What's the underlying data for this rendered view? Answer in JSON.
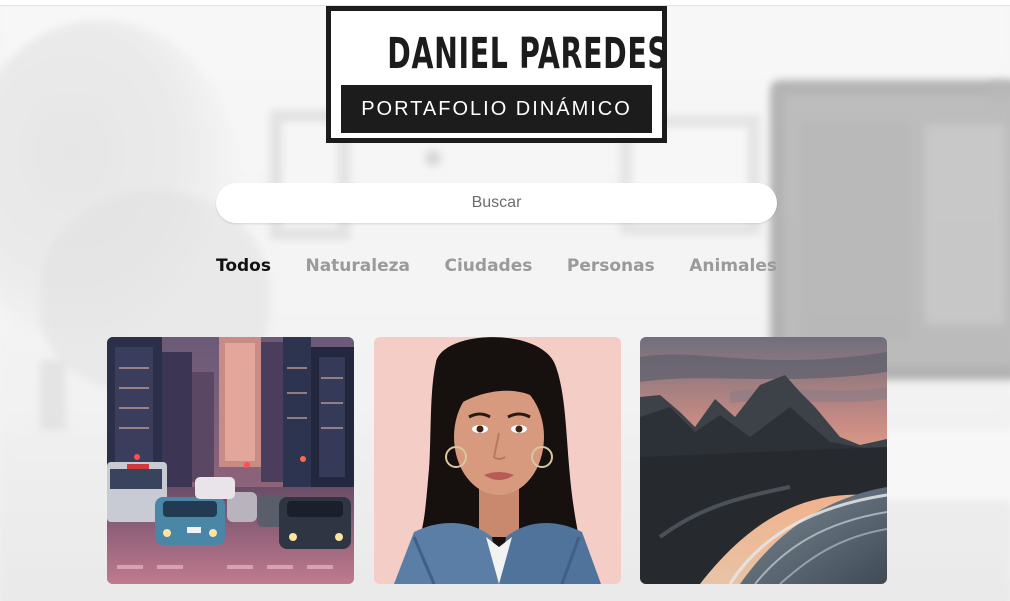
{
  "header": {
    "name": "DANIEL PAREDES",
    "subtitle": "PORTAFOLIO DINÁMICO"
  },
  "search": {
    "placeholder": "Buscar",
    "value": ""
  },
  "filters": [
    {
      "label": "Todos",
      "active": true
    },
    {
      "label": "Naturaleza",
      "active": false
    },
    {
      "label": "Ciudades",
      "active": false
    },
    {
      "label": "Personas",
      "active": false
    },
    {
      "label": "Animales",
      "active": false
    }
  ],
  "gallery": [
    {
      "category": "Ciudades",
      "subject": "city-street-traffic"
    },
    {
      "category": "Personas",
      "subject": "woman-portrait"
    },
    {
      "category": "Naturaleza",
      "subject": "mountain-beach-sunset"
    }
  ],
  "colors": {
    "logo_dark": "#1c1c1c",
    "filter_active": "#111111",
    "filter_inactive": "#9a9a9a",
    "search_bg": "#ffffff"
  }
}
